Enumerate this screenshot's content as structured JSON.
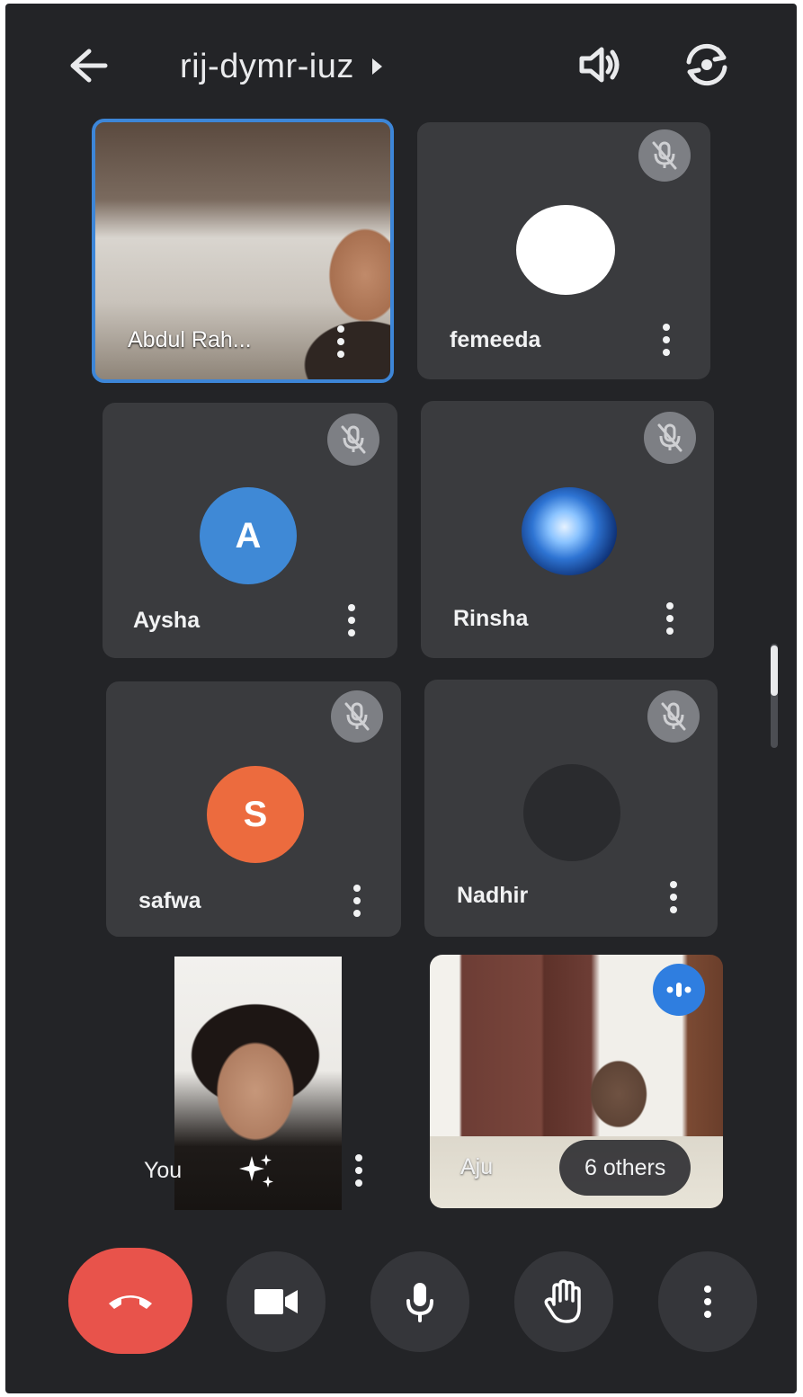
{
  "header": {
    "title": "rij-dymr-iuz",
    "back_icon": "arrow-left-icon",
    "speaker_icon": "speaker-icon",
    "switch_camera_icon": "switch-camera-icon"
  },
  "tiles": [
    {
      "name": "Abdul Rah...",
      "type": "video",
      "active": true
    },
    {
      "name": "femeeda",
      "type": "avatar",
      "muted": true,
      "avatar_color": "#ffffff"
    },
    {
      "name": "Aysha",
      "type": "avatar",
      "muted": true,
      "initial": "A",
      "avatar_color": "#3f89d6"
    },
    {
      "name": "Rinsha",
      "type": "avatar",
      "muted": true,
      "avatar_color": "#2a6fd0"
    },
    {
      "name": "safwa",
      "type": "avatar",
      "muted": true,
      "initial": "S",
      "avatar_color": "#ec6b3e"
    },
    {
      "name": "Nadhir",
      "type": "avatar",
      "muted": true,
      "avatar_color": "#2a2b2e"
    },
    {
      "name": "You",
      "type": "video",
      "effects_icon": "sparkles-icon"
    },
    {
      "name": "Aju",
      "type": "video",
      "speaking": true
    }
  ],
  "others": {
    "label": "6 others"
  },
  "controls": {
    "end_call_icon": "end-call-icon",
    "camera_icon": "camera-icon",
    "mic_icon": "microphone-icon",
    "raise_hand_icon": "raise-hand-icon",
    "more_icon": "more-vertical-icon"
  },
  "colors": {
    "background": "#232427",
    "tile": "#3a3b3e",
    "active_border": "#3d86d8",
    "end_call": "#e8534b",
    "speaking": "#2f7ee0"
  }
}
